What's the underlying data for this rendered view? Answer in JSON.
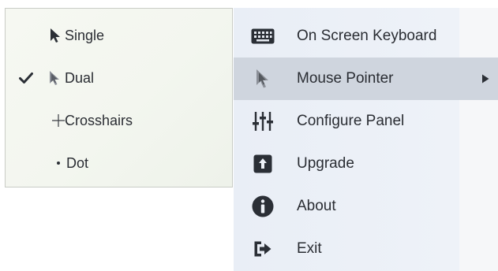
{
  "submenu": {
    "items": [
      {
        "label": "Single",
        "checked": false,
        "icon": "arrow-pointer-icon"
      },
      {
        "label": "Dual",
        "checked": true,
        "icon": "dual-pointer-icon"
      },
      {
        "label": "Crosshairs",
        "checked": false,
        "icon": "crosshair-icon"
      },
      {
        "label": "Dot",
        "checked": false,
        "icon": "dot-icon"
      }
    ]
  },
  "menu": {
    "items": [
      {
        "label": "On Screen Keyboard",
        "icon": "keyboard-icon"
      },
      {
        "label": "Mouse Pointer",
        "icon": "mouse-pointer-icon",
        "active": true,
        "has_submenu": true
      },
      {
        "label": "Configure Panel",
        "icon": "sliders-icon"
      },
      {
        "label": "Upgrade",
        "icon": "upgrade-icon"
      },
      {
        "label": "About",
        "icon": "info-icon"
      },
      {
        "label": "Exit",
        "icon": "exit-icon"
      }
    ]
  },
  "colors": {
    "active_row": "#cfd5de",
    "menu_bg": "#eef2f8",
    "icon": "#2b2f36"
  }
}
